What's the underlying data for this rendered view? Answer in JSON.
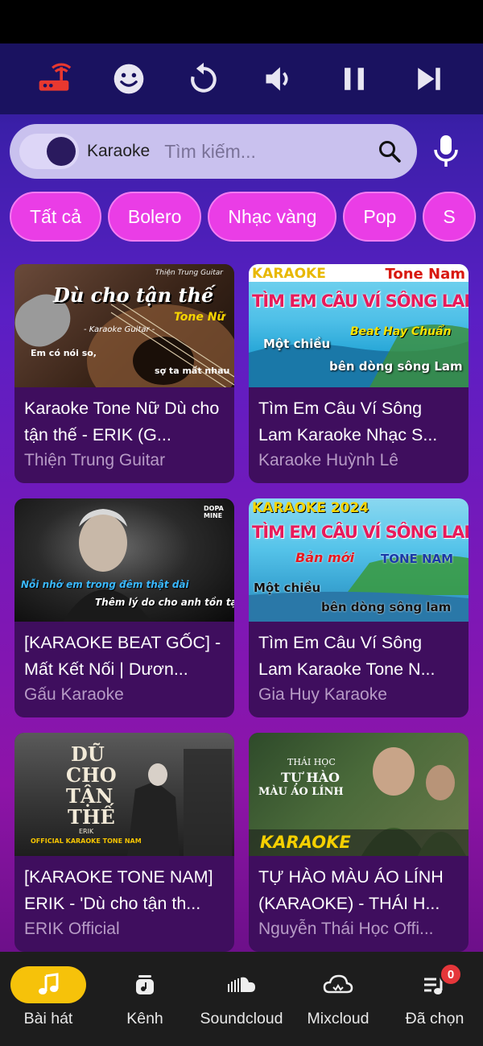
{
  "player": {
    "buttons": [
      {
        "name": "router-icon",
        "color": "#e8382f"
      },
      {
        "name": "emoji-icon"
      },
      {
        "name": "replay-icon"
      },
      {
        "name": "volume-icon"
      },
      {
        "name": "pause-icon"
      },
      {
        "name": "skip-next-icon"
      }
    ]
  },
  "search": {
    "mode_label": "Karaoke",
    "placeholder": "Tìm kiếm...",
    "value": ""
  },
  "chips": [
    "Tất cả",
    "Bolero",
    "Nhạc vàng",
    "Pop",
    "S"
  ],
  "videos": [
    {
      "title": "Karaoke Tone Nữ Dù cho tận thế - ERIK (G...",
      "channel": "Thiện Trung Guitar",
      "thumb": {
        "big": "Dù cho tận thế",
        "sub": "Tone Nữ",
        "tag": "- Karaoke Guitar -",
        "line1": "Em có nói so,",
        "line2": "sợ ta mất nhau",
        "credit": "Thiện Trung Guitar"
      }
    },
    {
      "title": "Tìm Em Câu Ví Sông Lam Karaoke Nhạc S...",
      "channel": "Karaoke Huỳnh Lê",
      "thumb": {
        "top_left": "KARAOKE",
        "top_right": "Tone Nam",
        "big": "TÌM EM CÂU VÍ SÔNG LAM",
        "beat": "Beat Hay Chuẩn",
        "line1": "Một chiều",
        "line2": "bên dòng sông Lam"
      }
    },
    {
      "title": "[KARAOKE BEAT GỐC]  -  Mất Kết Nối | Dươn...",
      "channel": "Gấu Karaoke",
      "thumb": {
        "logo": "DOPA MINE",
        "line1": "Nỗi nhớ em trong đêm thật dài",
        "line2": "Thêm lý do cho anh tồn tại"
      }
    },
    {
      "title": "Tìm Em Câu Ví Sông Lam Karaoke Tone N...",
      "channel": "Gia Huy Karaoke",
      "thumb": {
        "top_left": "KARAOKE 2024",
        "big": "TÌM EM CÂU VÍ SÔNG LAM",
        "sub": "Bản mới",
        "tone": "TONE NAM",
        "line1": "Một chiều",
        "line2": "bên dòng sông lam"
      }
    },
    {
      "title": "[KARAOKE TONE NAM] ERIK - 'Dù cho tận th...",
      "channel": "ERIK Official",
      "thumb": {
        "big1": "DŨ",
        "big2": "CHO",
        "big3": "TẬN",
        "big4": "THẾ",
        "artist": "ERIK",
        "bar": "OFFICIAL KARAOKE TONE NAM"
      }
    },
    {
      "title": "TỰ HÀO MÀU ÁO LÍNH (KARAOKE) - THÁI H...",
      "channel": "Nguyễn Thái Học Offi...",
      "thumb": {
        "artist": "THÁI HỌC",
        "big1": "TỰ HÀO",
        "big2": "MÀU ÁO LÍNH",
        "bar": "KARAOKE"
      }
    }
  ],
  "nav": {
    "items": [
      {
        "label": "Bài hát",
        "icon": "music-note-icon",
        "active": true
      },
      {
        "label": "Kênh",
        "icon": "channel-icon",
        "active": false
      },
      {
        "label": "Soundcloud",
        "icon": "soundcloud-icon",
        "active": false
      },
      {
        "label": "Mixcloud",
        "icon": "mixcloud-icon",
        "active": false
      },
      {
        "label": "Đã chọn",
        "icon": "playlist-icon",
        "active": false,
        "badge": "0"
      }
    ]
  },
  "colors": {
    "accent": "#f6c20a",
    "chip": "#ea3de6",
    "badge": "#e5363a"
  }
}
